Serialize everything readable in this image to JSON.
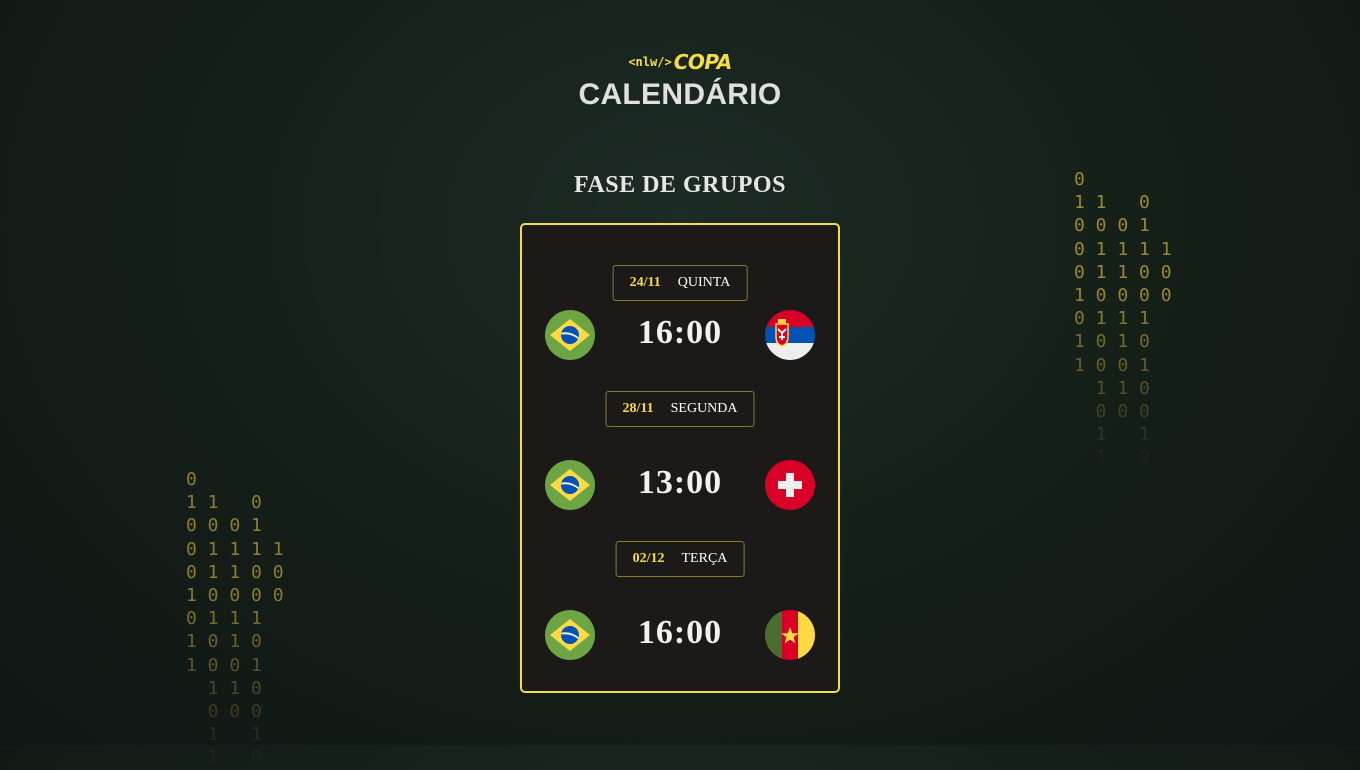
{
  "header": {
    "logo_small": "<nlw/>",
    "logo_big": "COPA",
    "title": "CALENDÁRIO"
  },
  "section": {
    "title": "FASE DE GRUPOS"
  },
  "matches": [
    {
      "date": "24/11",
      "weekday": "QUINTA",
      "time": "16:00",
      "home": "brazil-flag",
      "away": "serbia-flag"
    },
    {
      "date": "28/11",
      "weekday": "SEGUNDA",
      "time": "13:00",
      "home": "brazil-flag",
      "away": "switzerland-flag"
    },
    {
      "date": "02/12",
      "weekday": "TERÇA",
      "time": "16:00",
      "home": "brazil-flag",
      "away": "cameroon-flag"
    }
  ],
  "decor": {
    "binary_rain": "0\n1 1   0\n0 0 0 1\n0 1 1 1 1\n0 1 1 0 0\n1 0 0 0 0\n0 1 1 1\n1 0 1 0\n1 0 0 1\n  1 1 0\n  0 0 0\n  1   1\n  1   0"
  },
  "colors": {
    "accent": "#f7dd43",
    "card_bg": "#1c1a19",
    "background": "#152019"
  }
}
